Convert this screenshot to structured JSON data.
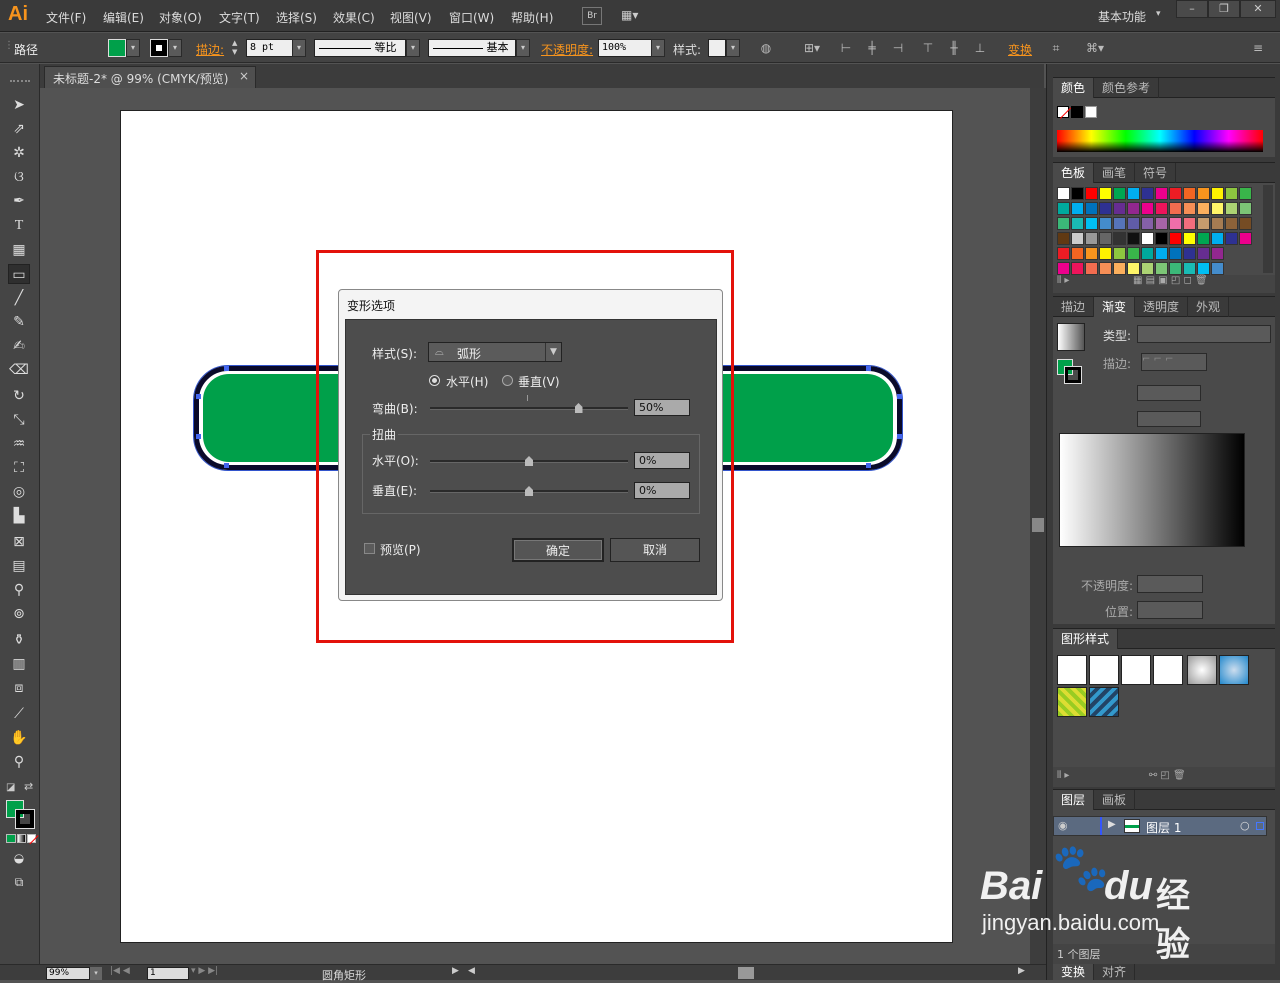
{
  "app": {
    "logo": "Ai"
  },
  "menu": [
    "文件(F)",
    "编辑(E)",
    "对象(O)",
    "文字(T)",
    "选择(S)",
    "效果(C)",
    "视图(V)",
    "窗口(W)",
    "帮助(H)"
  ],
  "menu_extra": {
    "br": "Br",
    "workspace": "基本功能"
  },
  "control": {
    "path_label": "路径",
    "stroke_label": "描边:",
    "stroke_value": "8 pt",
    "profile_label": "等比",
    "brush_label": "基本",
    "opacity_label": "不透明度:",
    "opacity_value": "100%",
    "style_label": "样式:",
    "transform_label": "变换"
  },
  "document": {
    "tab_title": "未标题-2* @ 99% (CMYK/预览)",
    "close": "×"
  },
  "colors": {
    "accent_green": "#00a04a",
    "red_highlight": "#e3120b"
  },
  "status": {
    "zoom": "99%",
    "page": "1",
    "object": "圆角矩形"
  },
  "right": {
    "color_tabs": [
      "颜色",
      "颜色参考"
    ],
    "swatch_tabs": [
      "色板",
      "画笔",
      "符号"
    ],
    "gradient_tabs": [
      "描边",
      "渐变",
      "透明度",
      "外观"
    ],
    "gradient": {
      "type_label": "类型:",
      "stroke_label": "描边:",
      "opacity_label": "不透明度:",
      "position_label": "位置:"
    },
    "graphic_styles_tab": "图形样式",
    "layers_tabs": [
      "图层",
      "画板"
    ],
    "layer_name": "图层 1",
    "layers_count": "1 个图层",
    "bottom_tabs": [
      "变换",
      "对齐"
    ]
  },
  "dialog": {
    "title": "变形选项",
    "style_label": "样式(S):",
    "style_value": "弧形",
    "horizontal": "水平(H)",
    "vertical": "垂直(V)",
    "bend_label": "弯曲(B):",
    "bend_value": "50%",
    "bend_fraction": 0.5,
    "distort_group": "扭曲",
    "distort_h_label": "水平(O):",
    "distort_h_value": "0%",
    "distort_v_label": "垂直(E):",
    "distort_v_value": "0%",
    "preview_label": "预览(P)",
    "ok": "确定",
    "cancel": "取消"
  },
  "watermark": {
    "brand": "Bai",
    "brand2": "du",
    "cn": "经验",
    "url": "jingyan.baidu.com"
  }
}
